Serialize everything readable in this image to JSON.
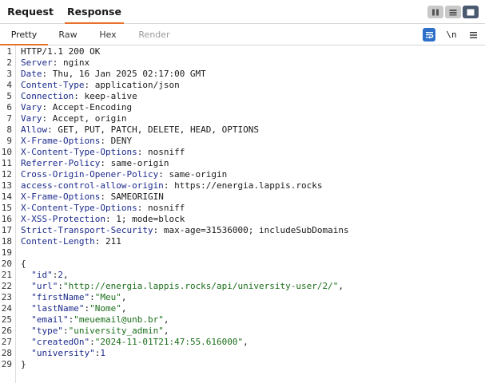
{
  "tabs": {
    "request_label": "Request",
    "response_label": "Response"
  },
  "layout_toggle": {
    "icons": [
      "split-vertical-icon",
      "split-horizontal-icon",
      "single-pane-icon"
    ],
    "active": "single-pane-icon"
  },
  "subtabs": {
    "pretty": "Pretty",
    "raw": "Raw",
    "hex": "Hex",
    "render": "Render"
  },
  "tools": {
    "wrap_icon": "word-wrap-icon",
    "newline_label": "\\n",
    "menu_icon": "hamburger-menu-icon"
  },
  "colors": {
    "accent": "#e8702a",
    "header_key": "#1c2a8c",
    "json_string": "#1a6e1a",
    "json_number": "#1c2a8c",
    "wrap_button": "#2d6fc9"
  },
  "response": {
    "status_line": "HTTP/1.1 200 OK",
    "headers": [
      {
        "name": "Server",
        "value": "nginx"
      },
      {
        "name": "Date",
        "value": "Thu, 16 Jan 2025 02:17:00 GMT"
      },
      {
        "name": "Content-Type",
        "value": "application/json"
      },
      {
        "name": "Connection",
        "value": "keep-alive"
      },
      {
        "name": "Vary",
        "value": "Accept-Encoding"
      },
      {
        "name": "Vary",
        "value": "Accept, origin"
      },
      {
        "name": "Allow",
        "value": "GET, PUT, PATCH, DELETE, HEAD, OPTIONS"
      },
      {
        "name": "X-Frame-Options",
        "value": "DENY"
      },
      {
        "name": "X-Content-Type-Options",
        "value": "nosniff"
      },
      {
        "name": "Referrer-Policy",
        "value": "same-origin"
      },
      {
        "name": "Cross-Origin-Opener-Policy",
        "value": "same-origin"
      },
      {
        "name": "access-control-allow-origin",
        "value": "https://energia.lappis.rocks"
      },
      {
        "name": "X-Frame-Options",
        "value": "SAMEORIGIN"
      },
      {
        "name": "X-Content-Type-Options",
        "value": "nosniff"
      },
      {
        "name": "X-XSS-Protection",
        "value": "1; mode=block"
      },
      {
        "name": "Strict-Transport-Security",
        "value": "max-age=31536000; includeSubDomains"
      },
      {
        "name": "Content-Length",
        "value": "211"
      }
    ],
    "body_open": "{",
    "body_fields": [
      {
        "key": "\"id\"",
        "value": "2",
        "type": "number"
      },
      {
        "key": "\"url\"",
        "value": "\"http://energia.lappis.rocks/api/university-user/2/\"",
        "type": "string"
      },
      {
        "key": "\"firstName\"",
        "value": "\"Meu\"",
        "type": "string"
      },
      {
        "key": "\"lastName\"",
        "value": "\"Nome\"",
        "type": "string"
      },
      {
        "key": "\"email\"",
        "value": "\"meuemail@unb.br\"",
        "type": "string"
      },
      {
        "key": "\"type\"",
        "value": "\"university_admin\"",
        "type": "string"
      },
      {
        "key": "\"createdOn\"",
        "value": "\"2024-11-01T21:47:55.616000\"",
        "type": "string"
      },
      {
        "key": "\"university\"",
        "value": "1",
        "type": "number"
      }
    ],
    "body_close": "}"
  }
}
